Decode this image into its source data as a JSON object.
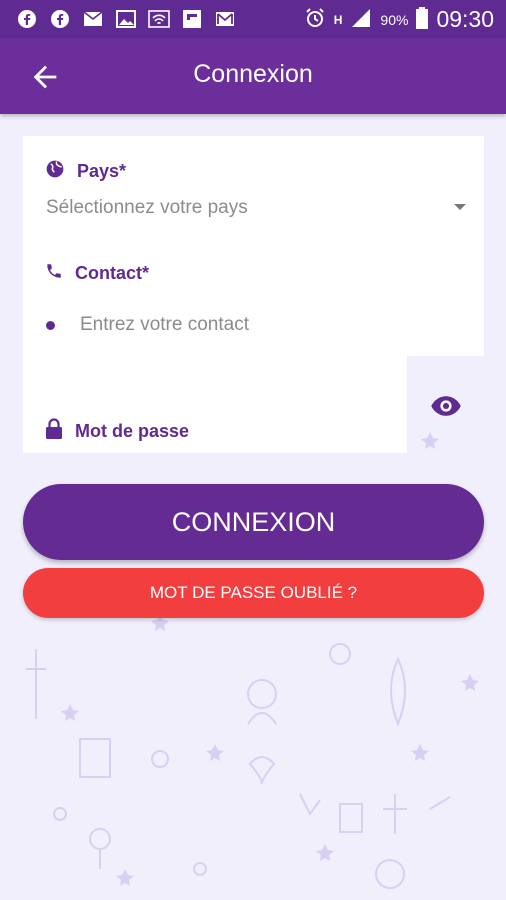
{
  "status_bar": {
    "battery": "90%",
    "time": "09:30",
    "network_label": "H",
    "notification_icons": [
      "facebook-icon",
      "facebook-icon",
      "mail-icon",
      "image-icon",
      "wifi-icon",
      "flipboard-icon",
      "gmail-icon"
    ]
  },
  "app_bar": {
    "title": "Connexion",
    "back_icon": "arrow-left-icon"
  },
  "form": {
    "country": {
      "label": "Pays*",
      "placeholder": "Sélectionnez votre pays",
      "icon": "globe-icon"
    },
    "contact": {
      "label": "Contact*",
      "placeholder": "Entrez votre contact",
      "icon": "phone-icon"
    },
    "password": {
      "label": "Mot de passe",
      "icon": "lock-icon",
      "toggle_icon": "eye-icon"
    }
  },
  "buttons": {
    "login": "CONNEXION",
    "forgot": "MOT DE PASSE OUBLIÉ ?"
  },
  "colors": {
    "primary": "#6b2e9b",
    "status_bar": "#5f2a91",
    "danger": "#f23e3e",
    "background": "#f1effc"
  }
}
